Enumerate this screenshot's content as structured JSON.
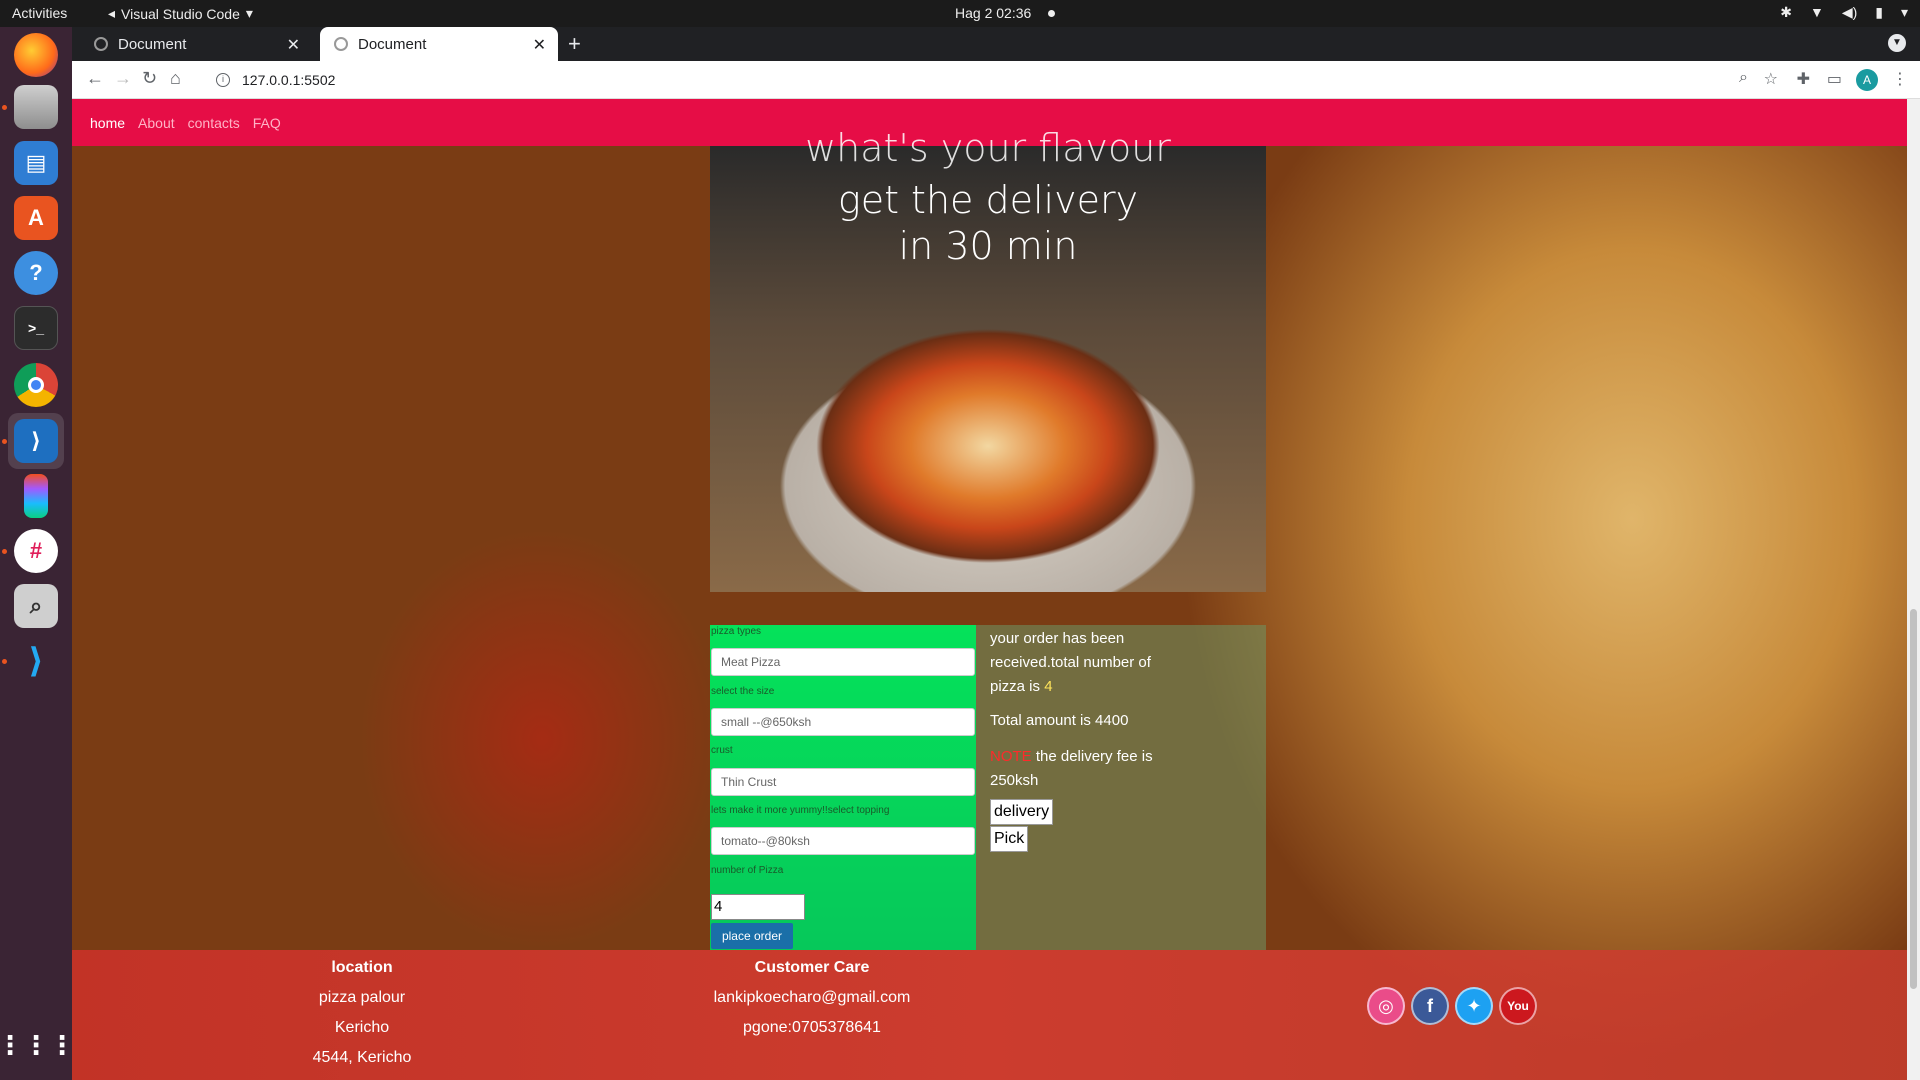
{
  "system": {
    "activities": "Activities",
    "app_name": "Visual Studio Code",
    "clock": "Hag 2  02:36"
  },
  "browser": {
    "tabs": [
      {
        "title": "Document"
      },
      {
        "title": "Document"
      }
    ],
    "url": "127.0.0.1:5502",
    "profile_initial": "A"
  },
  "site": {
    "nav": [
      {
        "label": "home"
      },
      {
        "label": "About"
      },
      {
        "label": "contacts"
      },
      {
        "label": "FAQ"
      }
    ],
    "hero": {
      "line1": "what's your flavour",
      "line2": "get the delivery",
      "line3": "in 30 min"
    },
    "form": {
      "pizza_types_label": "pizza types",
      "pizza_type_value": "Meat Pizza",
      "size_label": "select the size",
      "size_value": "small --@650ksh",
      "crust_label": "crust",
      "crust_value": "Thin Crust",
      "topping_label": "lets make it more yummy!!select topping",
      "topping_value": "tomato--@80ksh",
      "qty_label": "number of Pizza",
      "qty_value": "4",
      "submit_label": "place order"
    },
    "summary": {
      "received_text": "your order has been received.total number of pizza is",
      "pizza_count": "4",
      "total_text": "Total amount is 4400",
      "note_label": "NOTE",
      "note_text": "the delivery fee is 250ksh",
      "delivery_label": "delivery",
      "pick_label": "Pick"
    },
    "footer": {
      "location_title": "location",
      "location_lines": [
        "pizza palour",
        "Kericho",
        "4544, Kericho"
      ],
      "care_title": "Customer Care",
      "care_lines": [
        "lankipkoecharo@gmail.com",
        "pgone:0705378641"
      ],
      "social": [
        "dribbble-icon",
        "facebook-icon",
        "twitter-icon",
        "youtube-icon"
      ]
    },
    "colors": {
      "navbar": "#e60d46",
      "form_green": "#05e25a",
      "place_order": "#1a6fa8"
    }
  }
}
